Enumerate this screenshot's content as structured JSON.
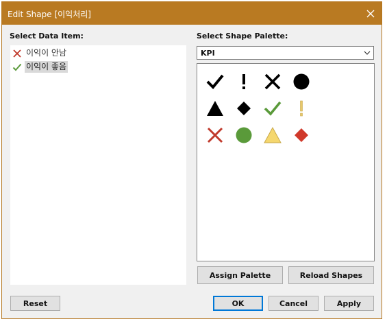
{
  "window": {
    "title": "Edit Shape [이익처리]"
  },
  "data_items": {
    "label": "Select Data Item:",
    "items": [
      {
        "label": "이익이 안남",
        "icon": "red-x-icon",
        "selected": false
      },
      {
        "label": "이익이 좋음",
        "icon": "green-check-icon",
        "selected": true
      }
    ]
  },
  "palette": {
    "label": "Select Shape Palette:",
    "selected": "KPI",
    "shapes": [
      "black-check-icon",
      "black-exclamation-icon",
      "black-x-icon",
      "black-circle-icon",
      "black-triangle-icon",
      "black-diamond-icon",
      "green-check-icon",
      "yellow-exclamation-icon",
      "red-x-icon",
      "green-circle-icon",
      "yellow-triangle-icon",
      "red-diamond-icon"
    ]
  },
  "buttons": {
    "assign_palette": "Assign Palette",
    "reload_shapes": "Reload Shapes",
    "reset": "Reset",
    "ok": "OK",
    "cancel": "Cancel",
    "apply": "Apply"
  },
  "colors": {
    "titlebar": "#b97a22",
    "red": "#c0392b",
    "green": "#5a9a3a",
    "yellow": "#f5d76e",
    "yellow_exclamation": "#e8c96a"
  }
}
